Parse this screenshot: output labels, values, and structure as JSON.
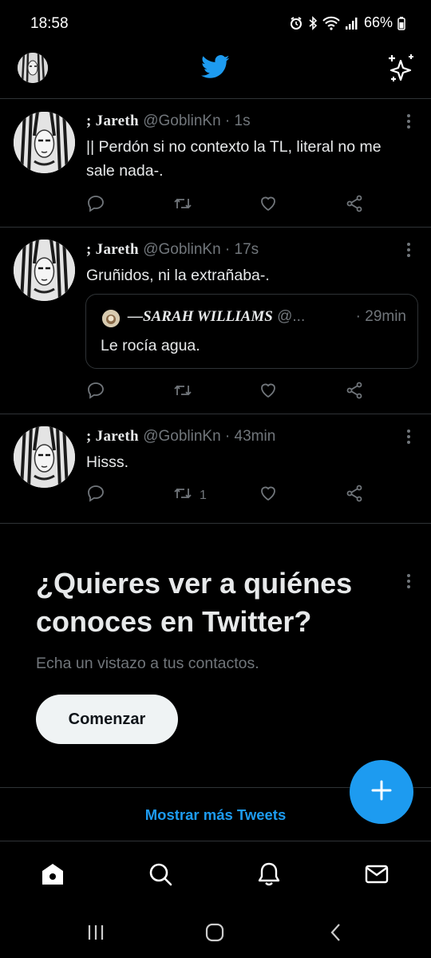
{
  "status_bar": {
    "time": "18:58",
    "battery": "66%",
    "icons": [
      "alarm-icon",
      "bluetooth-icon",
      "wifi-icon",
      "signal-icon",
      "battery-icon"
    ]
  },
  "header": {
    "logo_icon": "twitter-bird-icon",
    "right_icon": "sparkle-icon"
  },
  "tweets": [
    {
      "name": "; Jareth",
      "handle": "@GoblinKn",
      "separator": "·",
      "time": "1s",
      "text": "|| Perdón si no contexto la TL, literal no me sale nada-.",
      "retweet_count": ""
    },
    {
      "name": "; Jareth",
      "handle": "@GoblinKn",
      "separator": "·",
      "time": "17s",
      "text": "Gruñidos, ni la extrañaba-.",
      "retweet_count": "",
      "quote": {
        "name": "—SARAH WILLIAMS",
        "handle": "@...",
        "time": "· 29min",
        "text": "Le rocía agua."
      }
    },
    {
      "name": "; Jareth",
      "handle": "@GoblinKn",
      "separator": "·",
      "time": "43min",
      "text": "Hisss.",
      "retweet_count": "1"
    }
  ],
  "promo": {
    "title": "¿Quieres ver a quiénes conoces en Twitter?",
    "subtitle": "Echa un vistazo a tus contactos.",
    "button": "Comenzar"
  },
  "show_more": "Mostrar más Tweets",
  "bottom_nav": [
    "home-icon",
    "search-icon",
    "notifications-icon",
    "messages-icon"
  ],
  "colors": {
    "accent": "#1d9bf0",
    "background": "#000000",
    "muted": "#71767b",
    "border": "#2f3336"
  }
}
